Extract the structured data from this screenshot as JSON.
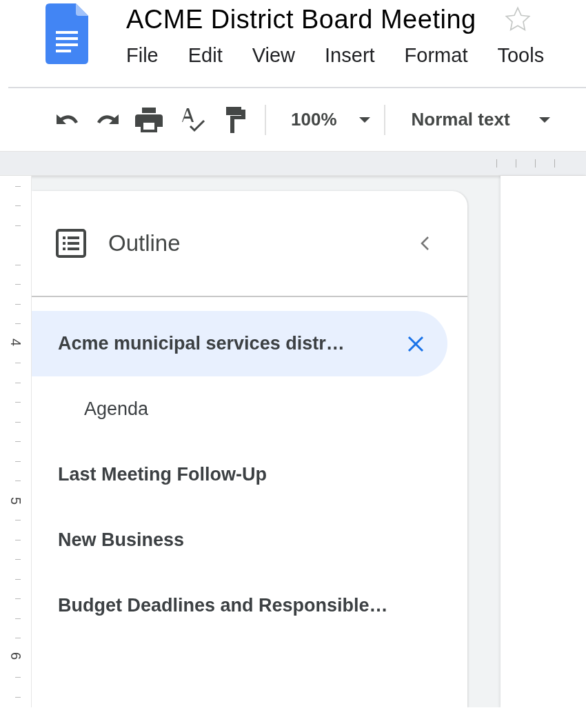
{
  "document": {
    "title": "ACME District Board Meeting",
    "starred": false
  },
  "menu": [
    "File",
    "Edit",
    "View",
    "Insert",
    "Format",
    "Tools"
  ],
  "toolbar": {
    "zoom": "100%",
    "style": "Normal text"
  },
  "ruler_marks": [
    "4",
    "5",
    "6"
  ],
  "outline": {
    "title": "Outline",
    "items": [
      {
        "text": "Acme municipal services distr…",
        "selected": true,
        "children": [
          {
            "text": "Agenda",
            "selected": false
          }
        ]
      },
      {
        "text": "Last Meeting Follow-Up",
        "selected": false
      },
      {
        "text": "New Business",
        "selected": false
      },
      {
        "text": "Budget Deadlines and Responsible…",
        "selected": false
      }
    ]
  }
}
